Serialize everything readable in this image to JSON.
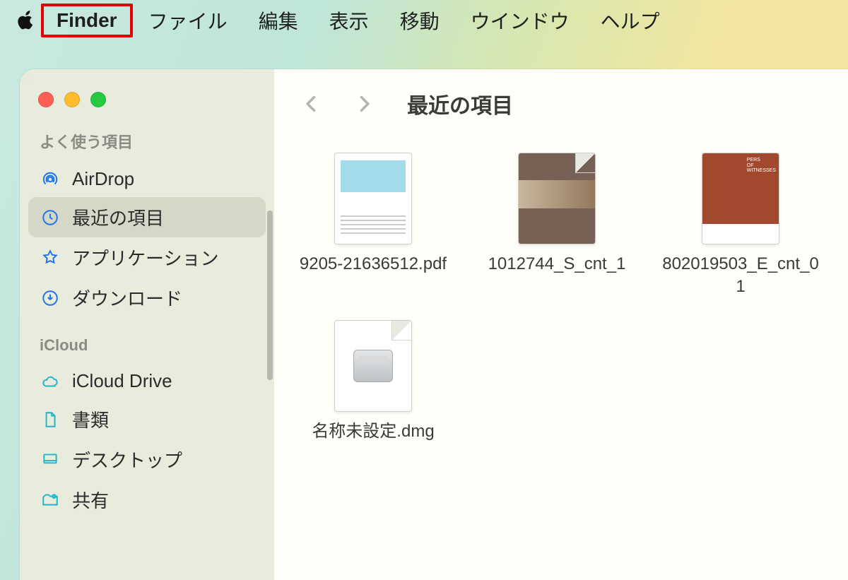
{
  "menubar": {
    "app_name": "Finder",
    "items": [
      "ファイル",
      "編集",
      "表示",
      "移動",
      "ウインドウ",
      "ヘルプ"
    ]
  },
  "sidebar": {
    "sections": [
      {
        "label": "よく使う項目",
        "items": [
          {
            "icon": "airdrop-icon",
            "label": "AirDrop",
            "selected": false
          },
          {
            "icon": "recent-icon",
            "label": "最近の項目",
            "selected": true
          },
          {
            "icon": "apps-icon",
            "label": "アプリケーション",
            "selected": false
          },
          {
            "icon": "downloads-icon",
            "label": "ダウンロード",
            "selected": false
          }
        ]
      },
      {
        "label": "iCloud",
        "items": [
          {
            "icon": "icloud-icon",
            "label": "iCloud Drive",
            "selected": false
          },
          {
            "icon": "documents-icon",
            "label": "書類",
            "selected": false
          },
          {
            "icon": "desktop-icon",
            "label": "デスクトップ",
            "selected": false
          },
          {
            "icon": "shared-icon",
            "label": "共有",
            "selected": false
          }
        ]
      }
    ]
  },
  "window": {
    "title": "最近の項目"
  },
  "files": [
    {
      "name": "9205-21636512.pdf",
      "thumb": "doc1"
    },
    {
      "name": "1012744_S_cnt_1",
      "thumb": "img2"
    },
    {
      "name": "802019503_E_cnt_01",
      "thumb": "doc3"
    },
    {
      "name": "名称未設定.dmg",
      "thumb": "dmg"
    }
  ]
}
